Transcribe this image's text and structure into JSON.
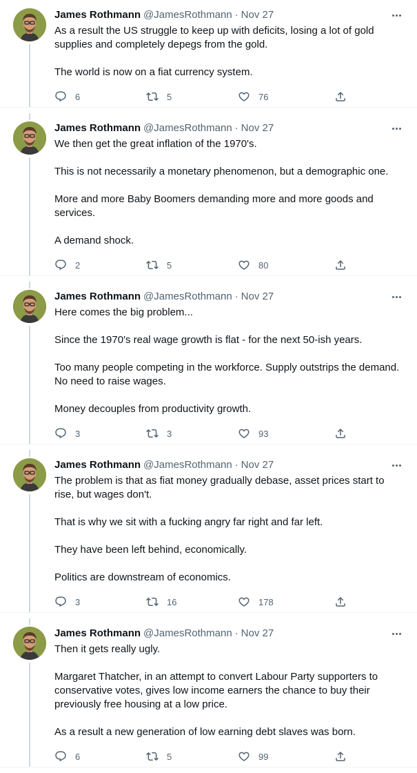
{
  "tweets": [
    {
      "name": "James Rothmann",
      "handle": "@JamesRothmann",
      "separator": "·",
      "date": "Nov 27",
      "paragraphs": [
        "As a result the US struggle to keep up with deficits, losing a lot of gold supplies and completely depegs from the gold.",
        "The world is now on a fiat currency system."
      ],
      "replies": "6",
      "retweets": "5",
      "likes": "76"
    },
    {
      "name": "James Rothmann",
      "handle": "@JamesRothmann",
      "separator": "·",
      "date": "Nov 27",
      "paragraphs": [
        "We then get the great inflation of the 1970's.",
        "This is not necessarily a monetary phenomenon, but a demographic one.",
        "More and more Baby Boomers demanding more and more goods and services.",
        "A demand shock."
      ],
      "replies": "2",
      "retweets": "5",
      "likes": "80"
    },
    {
      "name": "James Rothmann",
      "handle": "@JamesRothmann",
      "separator": "·",
      "date": "Nov 27",
      "paragraphs": [
        "Here comes the big problem...",
        "Since the 1970's real wage growth is flat - for the next 50-ish years.",
        "Too many people competing in the workforce. Supply outstrips the demand. No need to raise wages.",
        "Money decouples from productivity growth."
      ],
      "replies": "3",
      "retweets": "3",
      "likes": "93"
    },
    {
      "name": "James Rothmann",
      "handle": "@JamesRothmann",
      "separator": "·",
      "date": "Nov 27",
      "paragraphs": [
        "The problem is that as fiat money gradually debase,  asset prices start to rise, but wages don't.",
        "That is why we sit with a fucking angry far right and far left.",
        "They have been left behind, economically.",
        "Politics are downstream of economics."
      ],
      "replies": "3",
      "retweets": "16",
      "likes": "178"
    },
    {
      "name": "James Rothmann",
      "handle": "@JamesRothmann",
      "separator": "·",
      "date": "Nov 27",
      "paragraphs": [
        "Then it gets really ugly.",
        "Margaret Thatcher, in an attempt to convert Labour Party supporters to conservative votes, gives low income earners the chance to buy their previously free housing at a low price.",
        "As a result a new generation of low earning debt slaves was born."
      ],
      "replies": "6",
      "retweets": "5",
      "likes": "99"
    }
  ],
  "icons": {
    "reply": "reply-icon",
    "retweet": "retweet-icon",
    "like": "heart-icon",
    "share": "share-icon",
    "more": "more-icon"
  },
  "colors": {
    "text": "#0f1419",
    "secondary": "#536471",
    "divider": "#eff3f4",
    "thread_line": "#cfd9de"
  }
}
